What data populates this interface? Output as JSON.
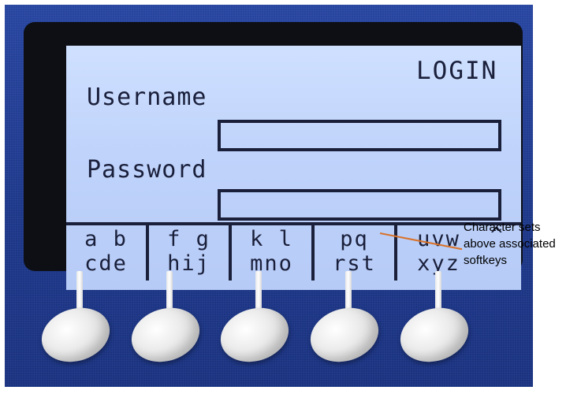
{
  "screen": {
    "title": "LOGIN",
    "username_label": "Username",
    "password_label": "Password",
    "username_value": "",
    "password_value": ""
  },
  "softkeys": [
    {
      "line1": "a b",
      "line2": "cde"
    },
    {
      "line1": "f g",
      "line2": "hij"
    },
    {
      "line1": "k l",
      "line2": "mno"
    },
    {
      "line1": "pq",
      "line2": "rst"
    },
    {
      "line1": "uvw",
      "line2": "xyz"
    }
  ],
  "caret": "^",
  "annotation": {
    "line1": "Character sets",
    "line2": "above associated",
    "line3": "softkeys"
  },
  "colors": {
    "panel": "#1f3a8a",
    "lcd": "#c4d7fb",
    "lcd_text": "#1a1f3a",
    "annotation_line": "#d9722a"
  }
}
